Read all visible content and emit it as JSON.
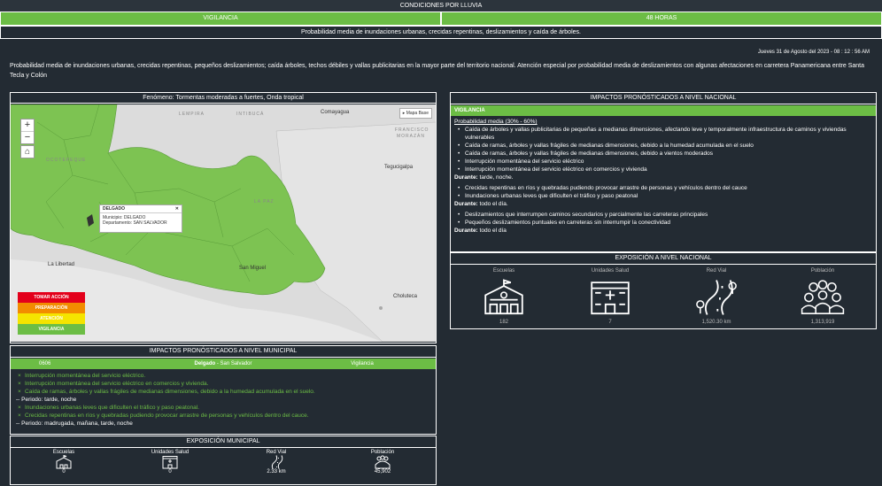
{
  "header": {
    "title": "CONDICIONES POR LLUVIA",
    "level": "VIGILANCIA",
    "duration": "48 HORAS",
    "subtitle": "Probabilidad media de inundaciones urbanas, crecidas repentinas, deslizamientos y caída de árboles."
  },
  "date": "Jueves 31 de Agosto del 2023 - 08 : 12 : 56 AM",
  "description": "Probabilidad media de inundaciones urbanas, crecidas repentinas, pequeños deslizamientos; caída árboles, techos débiles y vallas publicitarias en la mayor parte del territorio nacional. Atención especial por probabilidad media de deslizamientos con algunas afectaciones en carretera Panamericana entre Santa Tecla y Colón",
  "map": {
    "phenomenon": "Fenómeno: Tormentas moderadas a fuertes, Onda tropical",
    "zoom_in": "+",
    "zoom_out": "−",
    "home": "⌂",
    "basemap_label": "Mapa Base",
    "popup": {
      "title": "DELGADO",
      "close": "✕",
      "line1": "Municipio: DELGADO",
      "line2": "Departamento: SAN SALVADOR"
    },
    "labels": {
      "lempira": "LEMPIRA",
      "intibuca": "INTIBUCÁ",
      "comayagua": "Comayagua",
      "francisco": "FRANCISCO",
      "morazan": "MORAZÁN",
      "tegucigalpa": "Tegucigalpa",
      "ocotepeque": "OCOTEPEQUE",
      "lapaz": "LA PAZ",
      "la_libertad": "La Libertad",
      "san_miguel": "San Miguel",
      "choluteca": "Choluteca"
    },
    "legend": [
      {
        "label": "TOMAR ACCIÓN",
        "color": "#e3001b"
      },
      {
        "label": "PREPARACIÓN",
        "color": "#f28c00"
      },
      {
        "label": "ATENCIÓN",
        "color": "#f5e400"
      },
      {
        "label": "VIGILANCIA",
        "color": "#6cbd45"
      }
    ]
  },
  "national": {
    "title": "IMPACTOS PRONÓSTICADOS A NIVEL NACIONAL",
    "level": "VIGILANCIA",
    "probability": "Probabilidad media (30% - 60%)",
    "group1": [
      "Caída de árboles y vallas publicitarias de pequeñas a medianas dimensiones, afectando leve y temporalmente infraestructura de caminos y viviendas vulnerables",
      "Caída de ramas, árboles y vallas frágiles de medianas dimensiones, debido a la humedad acumulada en el suelo",
      "Caída de ramas, árboles y vallas frágiles de medianas dimensiones, debido a vientos moderados",
      "Interrupción momentánea del servicio eléctrico",
      "Interrupción momentánea del servicio eléctrico en comercios y vivienda"
    ],
    "during1_label": "Durante:",
    "during1": "tarde, noche.",
    "group2": [
      "Crecidas repentinas en ríos y quebradas pudiendo provocar arrastre de personas y vehículos dentro del cauce",
      "Inundaciones urbanas leves que dificulten el tráfico y paso peatonal"
    ],
    "during2_label": "Durante:",
    "during2": "todo el día.",
    "group3": [
      "Deslizamientos que interrumpen caminos secundarios y parcialmente las carreteras principales",
      "Pequeños deslizamientos puntuales en carreteras sin interrumpir la conectividad"
    ],
    "during3_label": "Durante:",
    "during3": "todo el día"
  },
  "national_exposure": {
    "title": "EXPOSICIÓN A NIVEL NACIONAL",
    "items": [
      {
        "label": "Escuelas",
        "value": "182",
        "icon": "school-icon"
      },
      {
        "label": "Unidades Salud",
        "value": "7",
        "icon": "hospital-icon"
      },
      {
        "label": "Red Vial",
        "value": "1,520.30 km",
        "icon": "road-icon"
      },
      {
        "label": "Población",
        "value": "1,313,919",
        "icon": "population-icon"
      }
    ]
  },
  "municipal": {
    "title": "IMPACTOS PRONÓSTICADOS A NIVEL MUNICIPAL",
    "code": "0606",
    "name": "Delgado",
    "department": " - San Salvador",
    "level": "Vigilancia",
    "items": [
      "Interrupción momentánea del servicio eléctrico.",
      "Interrupción momentánea del servicio eléctrico en comercios y vivienda.",
      "Caída de ramas, árboles y vallas frágiles de medianas dimensiones, debido a la humedad acumulada en el suelo."
    ],
    "period1": "-- Periodo: tarde, noche",
    "items2": [
      "Inundaciones urbanas leves que dificulten el tráfico y paso peatonal.",
      "Crecidas repentinas en ríos y quebradas pudiendo provocar arrastre de personas y vehículos dentro del cauce."
    ],
    "period2": "-- Periodo: madrugada, mañana, tarde, noche"
  },
  "municipal_exposure": {
    "title": "EXPOSICIÓN MUNICIPAL",
    "items": [
      {
        "label": "Escuelas",
        "value": "0",
        "icon": "school-icon"
      },
      {
        "label": "Unidades Salud",
        "value": "0",
        "icon": "hospital-icon"
      },
      {
        "label": "Red Vial",
        "value": "2.33 km",
        "icon": "road-icon"
      },
      {
        "label": "Población",
        "value": "45,902",
        "icon": "population-icon"
      }
    ]
  }
}
